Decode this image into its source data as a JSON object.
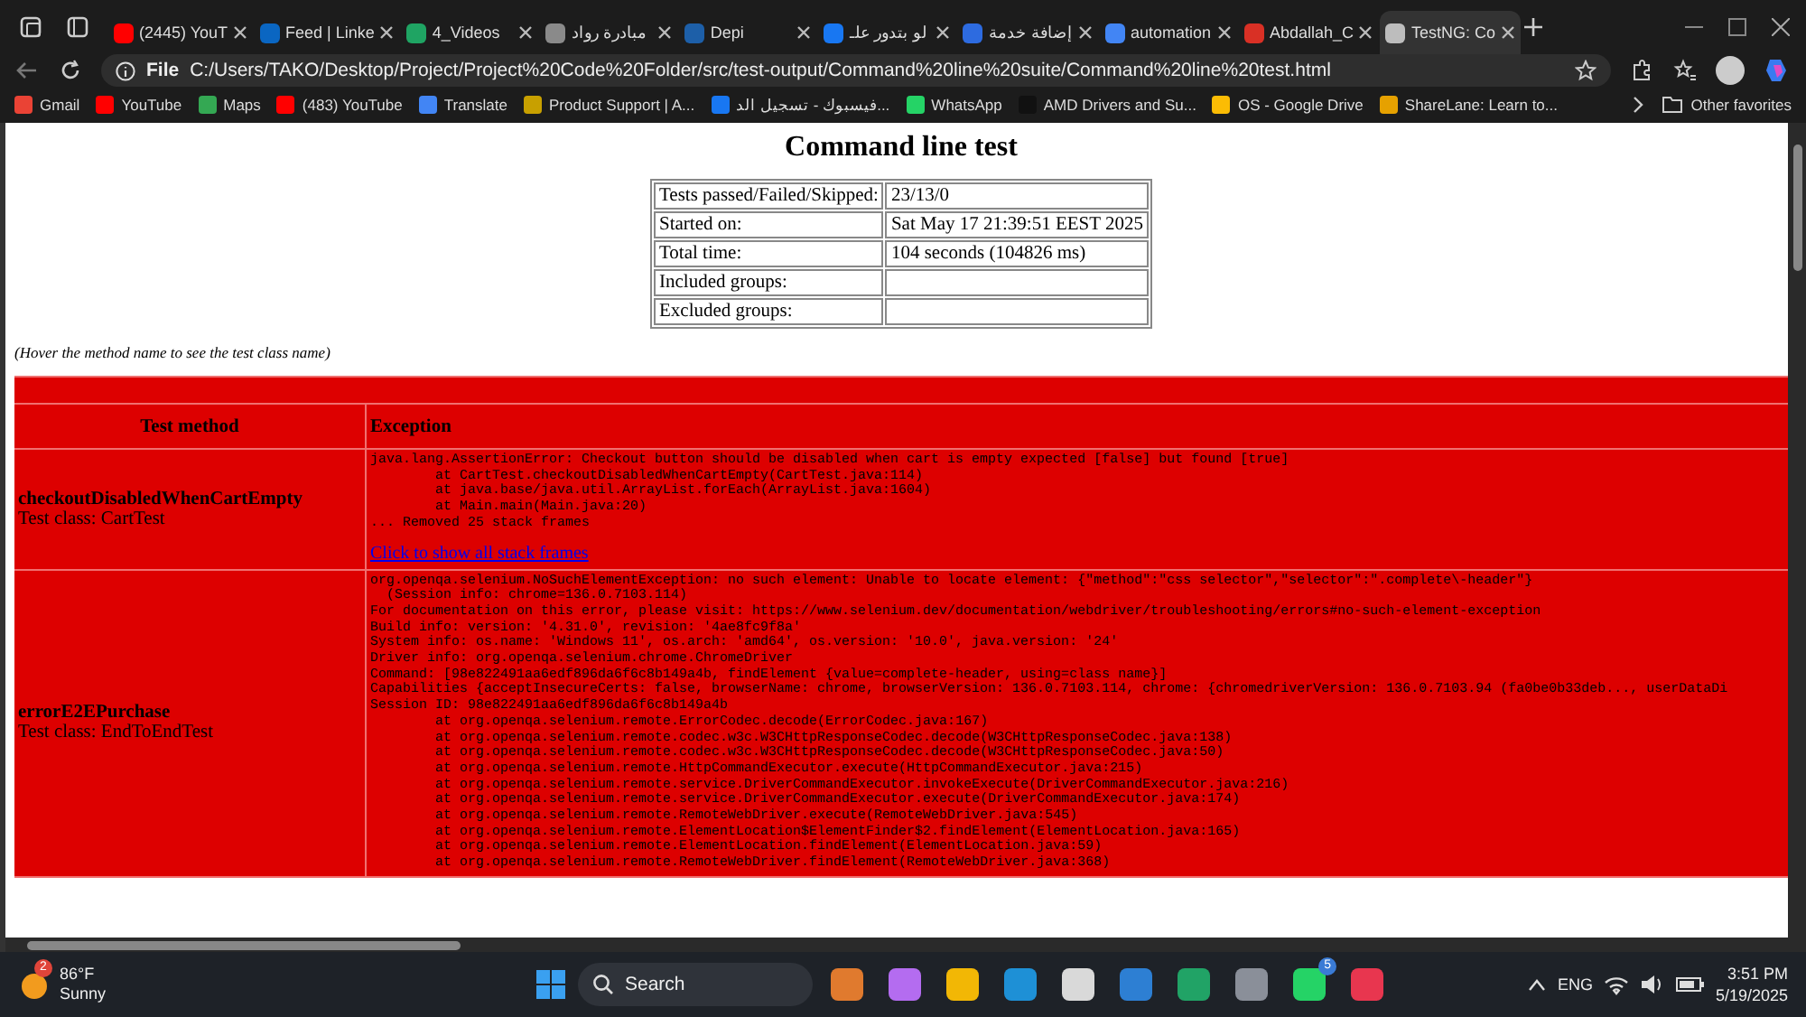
{
  "tabs": [
    {
      "title": "(2445) YouT",
      "color": "#ff0000",
      "selected": false
    },
    {
      "title": "Feed | Linke",
      "color": "#0a66c2",
      "selected": false
    },
    {
      "title": "4_Videos",
      "color": "#1fa463",
      "selected": false
    },
    {
      "title": "مبادرة رواد",
      "color": "#8a8a8a",
      "selected": false
    },
    {
      "title": "Depi",
      "color": "#1d5fa8",
      "selected": false
    },
    {
      "title": "لو بتدور علـ",
      "color": "#1877f2",
      "selected": false
    },
    {
      "title": "إضافة خدمة",
      "color": "#2d6be0",
      "selected": false
    },
    {
      "title": "automation",
      "color": "#4285f4",
      "selected": false
    },
    {
      "title": "Abdallah_C",
      "color": "#d93025",
      "selected": false
    },
    {
      "title": "TestNG: Co",
      "color": "#bdbdbd",
      "selected": true
    }
  ],
  "address_bar": {
    "scheme": "File",
    "url": "C:/Users/TAKO/Desktop/Project/Project%20Code%20Folder/src/test-output/Command%20line%20suite/Command%20line%20test.html"
  },
  "bookmarks": [
    {
      "label": "Gmail",
      "color": "#ea4335"
    },
    {
      "label": "YouTube",
      "color": "#ff0000"
    },
    {
      "label": "Maps",
      "color": "#34a853"
    },
    {
      "label": "(483) YouTube",
      "color": "#ff0000"
    },
    {
      "label": "Translate",
      "color": "#4285f4"
    },
    {
      "label": "Product Support | A...",
      "color": "#c8a000"
    },
    {
      "label": "فيسبوك - تسجيل الد...",
      "color": "#1877f2"
    },
    {
      "label": "WhatsApp",
      "color": "#25d366"
    },
    {
      "label": "AMD Drivers and Su...",
      "color": "#111111"
    },
    {
      "label": "OS - Google Drive",
      "color": "#fbbc04"
    },
    {
      "label": "ShareLane: Learn to...",
      "color": "#e6a100"
    }
  ],
  "other_favorites": "Other favorites",
  "report": {
    "title": "Command line test",
    "summary": [
      {
        "label": "Tests passed/Failed/Skipped:",
        "value": "23/13/0"
      },
      {
        "label": "Started on:",
        "value": "Sat May 17 21:39:51 EEST 2025"
      },
      {
        "label": "Total time:",
        "value": "104 seconds (104826 ms)"
      },
      {
        "label": "Included groups:"
      },
      {
        "label": "Excluded groups:"
      }
    ],
    "note": "(Hover the method name to see the test class name)",
    "columns": [
      "Test method",
      "Exception"
    ],
    "rows": [
      {
        "method": "checkoutDisabledWhenCartEmpty",
        "test_class": "Test class: CartTest",
        "link": "Click to show all stack frames",
        "exception": [
          "java.lang.AssertionError: Checkout button should be disabled when cart is empty expected [false] but found [true]",
          "\tat CartTest.checkoutDisabledWhenCartEmpty(CartTest.java:114)",
          "\tat java.base/java.util.ArrayList.forEach(ArrayList.java:1604)",
          "\tat Main.main(Main.java:20)",
          "... Removed 25 stack frames"
        ]
      },
      {
        "method": "errorE2EPurchase",
        "test_class": "Test class: EndToEndTest",
        "exception": [
          "org.openqa.selenium.NoSuchElementException: no such element: Unable to locate element: {\"method\":\"css selector\",\"selector\":\".complete\\-header\"}",
          "  (Session info: chrome=136.0.7103.114)",
          "For documentation on this error, please visit: https://www.selenium.dev/documentation/webdriver/troubleshooting/errors#no-such-element-exception",
          "Build info: version: '4.31.0', revision: '4ae8fc9f8a'",
          "System info: os.name: 'Windows 11', os.arch: 'amd64', os.version: '10.0', java.version: '24'",
          "Driver info: org.openqa.selenium.chrome.ChromeDriver",
          "Command: [98e822491aa6edf896da6f6c8b149a4b, findElement {value=complete-header, using=class name}]",
          "Capabilities {acceptInsecureCerts: false, browserName: chrome, browserVersion: 136.0.7103.114, chrome: {chromedriverVersion: 136.0.7103.94 (fa0be0b33deb..., userDataDi",
          "Session ID: 98e822491aa6edf896da6f6c8b149a4b",
          "\tat org.openqa.selenium.remote.ErrorCodec.decode(ErrorCodec.java:167)",
          "\tat org.openqa.selenium.remote.codec.w3c.W3CHttpResponseCodec.decode(W3CHttpResponseCodec.java:138)",
          "\tat org.openqa.selenium.remote.codec.w3c.W3CHttpResponseCodec.decode(W3CHttpResponseCodec.java:50)",
          "\tat org.openqa.selenium.remote.HttpCommandExecutor.execute(HttpCommandExecutor.java:215)",
          "\tat org.openqa.selenium.remote.service.DriverCommandExecutor.invokeExecute(DriverCommandExecutor.java:216)",
          "\tat org.openqa.selenium.remote.service.DriverCommandExecutor.execute(DriverCommandExecutor.java:174)",
          "\tat org.openqa.selenium.remote.RemoteWebDriver.execute(RemoteWebDriver.java:545)",
          "\tat org.openqa.selenium.remote.ElementLocation$ElementFinder$2.findElement(ElementLocation.java:165)",
          "\tat org.openqa.selenium.remote.ElementLocation.findElement(ElementLocation.java:59)",
          "\tat org.openqa.selenium.remote.RemoteWebDriver.findElement(RemoteWebDriver.java:368)"
        ]
      }
    ]
  },
  "taskbar": {
    "weather": {
      "badge": "2",
      "temperature": "86°F",
      "condition": "Sunny"
    },
    "search": "Search",
    "apps": [
      {
        "color": "#e07a2e"
      },
      {
        "color": "#b46cf0"
      },
      {
        "color": "#f2b705"
      },
      {
        "color": "#1e90d6"
      },
      {
        "color": "#d9d9d9"
      },
      {
        "color": "#2d7fd3"
      },
      {
        "color": "#21a366"
      },
      {
        "color": "#8a8f99"
      },
      {
        "color": "#25d366",
        "badge": "5"
      },
      {
        "color": "#e8364f"
      }
    ],
    "language": "ENG",
    "time": "3:51 PM",
    "date": "5/19/2025"
  }
}
